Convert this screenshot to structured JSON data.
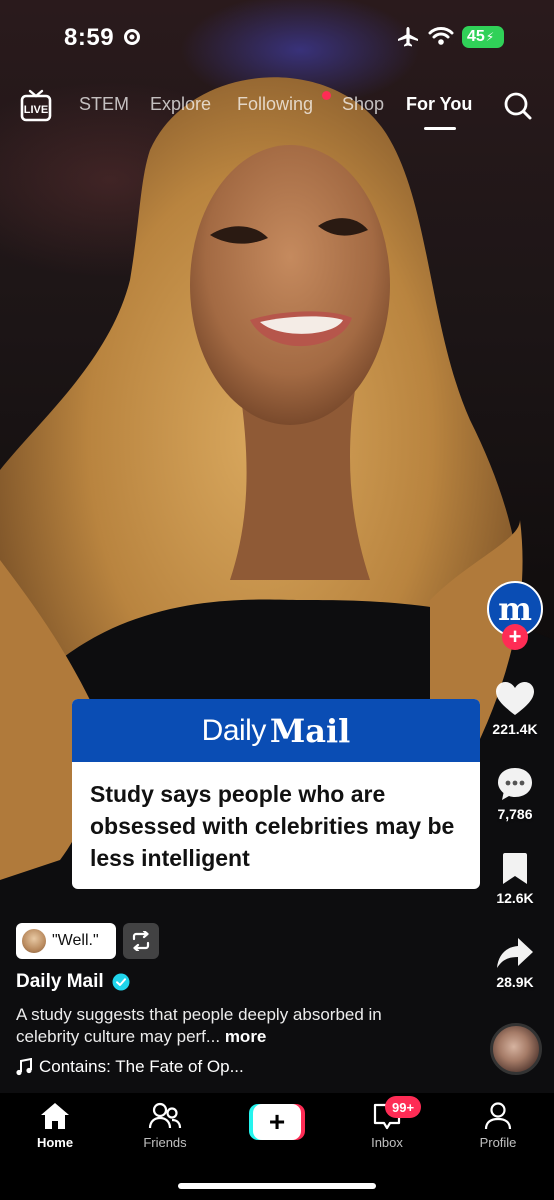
{
  "status_bar": {
    "time": "8:59",
    "battery": "45"
  },
  "top_nav": {
    "tabs": [
      {
        "label": "STEM"
      },
      {
        "label": "Explore"
      },
      {
        "label": "Following"
      },
      {
        "label": "Shop"
      },
      {
        "label": "For You"
      }
    ],
    "active_tab": "For You",
    "live_icon": "live-icon",
    "search_icon": "search-icon"
  },
  "news_card": {
    "brand_daily": "Daily",
    "brand_mail": "Mail",
    "headline": "Study says people who are obsessed with celebrities may be less intelligent",
    "header_color": "#0a4db4"
  },
  "actions": {
    "likes": "221.4K",
    "comments": "7,786",
    "saves": "12.6K",
    "shares": "28.9K",
    "avatar_letter": "m"
  },
  "post": {
    "quote": "\"Well.\"",
    "author": "Daily Mail",
    "description": "A study suggests that people deeply absorbed in celebrity culture may perf...",
    "more": "more",
    "music": "Contains: The Fate of Op..."
  },
  "bottom_nav": {
    "home": "Home",
    "friends": "Friends",
    "create": "+",
    "inbox": "Inbox",
    "inbox_badge": "99+",
    "profile": "Profile"
  },
  "colors": {
    "accent_red": "#fe2c55",
    "accent_cyan": "#25f4ee",
    "battery_green": "#30d158"
  }
}
